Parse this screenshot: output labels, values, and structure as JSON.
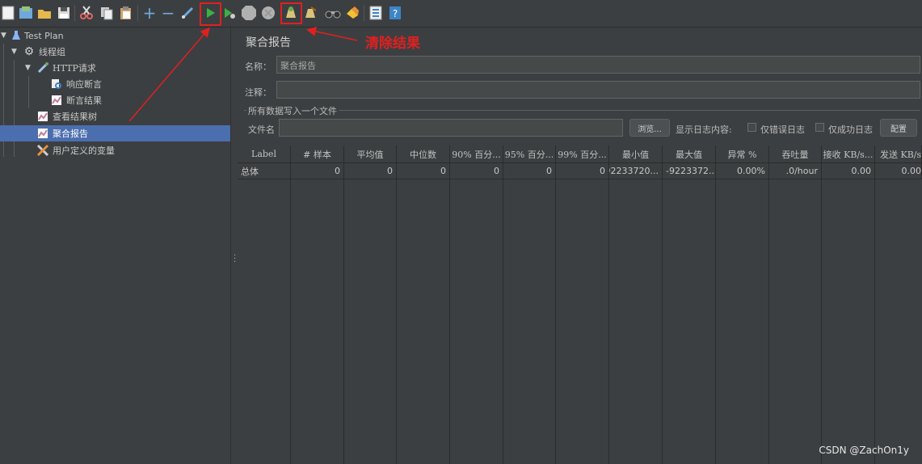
{
  "toolbar": {
    "icons": [
      "new-icon",
      "templates-icon",
      "open-icon",
      "save-icon",
      "cut-icon",
      "copy-icon",
      "paste-icon",
      "expand-icon",
      "collapse-icon",
      "toggle-icon",
      "start-icon",
      "start-no-pause-icon",
      "stop-icon",
      "shutdown-icon",
      "clear-icon",
      "clear-all-icon",
      "search-icon",
      "reset-search-icon",
      "function-helper-icon",
      "help-icon"
    ]
  },
  "tree": {
    "items": [
      {
        "label": "Test Plan",
        "icon": "flask-icon"
      },
      {
        "label": "线程组",
        "icon": "gear-icon"
      },
      {
        "label": "HTTP请求",
        "icon": "pipette-icon"
      },
      {
        "label": "响应断言",
        "icon": "magnifier-icon"
      },
      {
        "label": "断言结果",
        "icon": "chart-icon"
      },
      {
        "label": "查看结果树",
        "icon": "chart-icon"
      },
      {
        "label": "聚合报告",
        "icon": "chart-icon"
      },
      {
        "label": "用户定义的变量",
        "icon": "wrench-icon"
      }
    ]
  },
  "panel": {
    "title": "聚合报告",
    "name_label": "名称：",
    "name_value": "聚合报告",
    "comment_label": "注释：",
    "comment_value": "",
    "file_group_title": "所有数据写入一个文件",
    "filename_label": "文件名",
    "filename_value": "",
    "browse_label": "浏览...",
    "log_content_label": "显示日志内容:",
    "errors_only_label": "仅错误日志",
    "success_only_label": "仅成功日志",
    "configure_label": "配置"
  },
  "table": {
    "columns": [
      "Label",
      "# 样本",
      "平均值",
      "中位数",
      "90% 百分...",
      "95% 百分...",
      "99% 百分...",
      "最小值",
      "最大值",
      "异常 %",
      "吞吐量",
      "接收 KB/s...",
      "发送 KB/s..."
    ],
    "rows": [
      [
        "总体",
        "0",
        "0",
        "0",
        "0",
        "0",
        "0",
        "92233720...",
        "-9223372...",
        "0.00%",
        ".0/hour",
        "0.00",
        "0.00"
      ]
    ]
  },
  "annotation": {
    "text": "清除结果",
    "color": "#e02020"
  },
  "watermark": "CSDN @ZachOn1y"
}
